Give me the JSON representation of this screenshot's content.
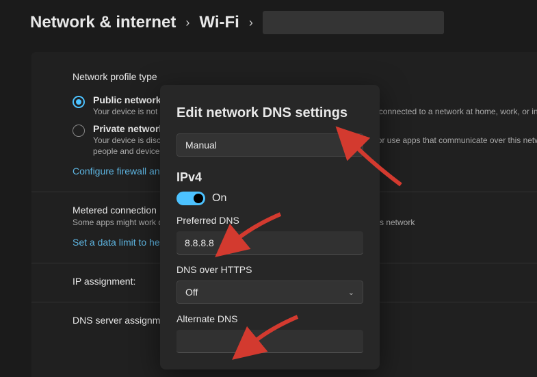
{
  "breadcrumb": {
    "level1": "Network & internet",
    "level2": "Wi-Fi"
  },
  "profile": {
    "section_title": "Network profile type",
    "public_label": "Public network (",
    "public_sub": "Your device is not discoverable on the network. Use this in most cases—when connected to a network at home, work, or in a public place.",
    "private_label": "Private network",
    "private_sub": "Your device is discoverable on the network. Select this if you need file sharing or use apps that communicate over this network. You should know and trust the",
    "private_sub2": "people and devices on the network.",
    "firewall_link": "Configure firewall and security settings"
  },
  "metered": {
    "title": "Metered connection",
    "sub": "Some apps might work differently to reduce data usage when you're connected to this network",
    "limit_link": "Set a data limit to help control data usage"
  },
  "rows": {
    "ip_label": "IP assignment:",
    "dns_label": "DNS server assignment:"
  },
  "modal": {
    "title": "Edit network DNS settings",
    "mode_value": "Manual",
    "ipv4_heading": "IPv4",
    "toggle_label": "On",
    "preferred_label": "Preferred DNS",
    "preferred_value": "8.8.8.8",
    "doh_label": "DNS over HTTPS",
    "doh_value": "Off",
    "alternate_label": "Alternate DNS",
    "alternate_value": ""
  },
  "annotations": {
    "arrow_color": "#d33a2f"
  }
}
